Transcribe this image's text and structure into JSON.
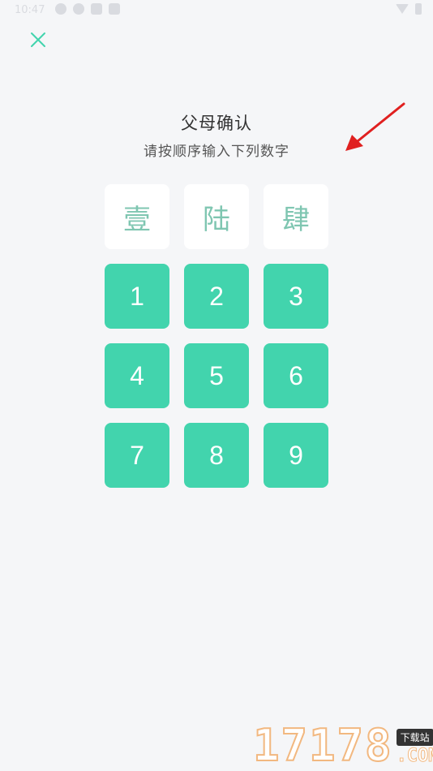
{
  "status_bar": {
    "time": "10:47"
  },
  "dialog": {
    "title": "父母确认",
    "subtitle": "请按顺序输入下列数字"
  },
  "prompt_digits": [
    "壹",
    "陆",
    "肆"
  ],
  "keypad": {
    "keys": [
      "1",
      "2",
      "3",
      "4",
      "5",
      "6",
      "7",
      "8",
      "9"
    ]
  },
  "colors": {
    "accent": "#42d4ad",
    "prompt_text": "#7fc6b1",
    "annotation_arrow": "#e02020"
  },
  "watermark": {
    "digits": "17178",
    "badge": "下载站",
    "suffix": ".COM"
  }
}
